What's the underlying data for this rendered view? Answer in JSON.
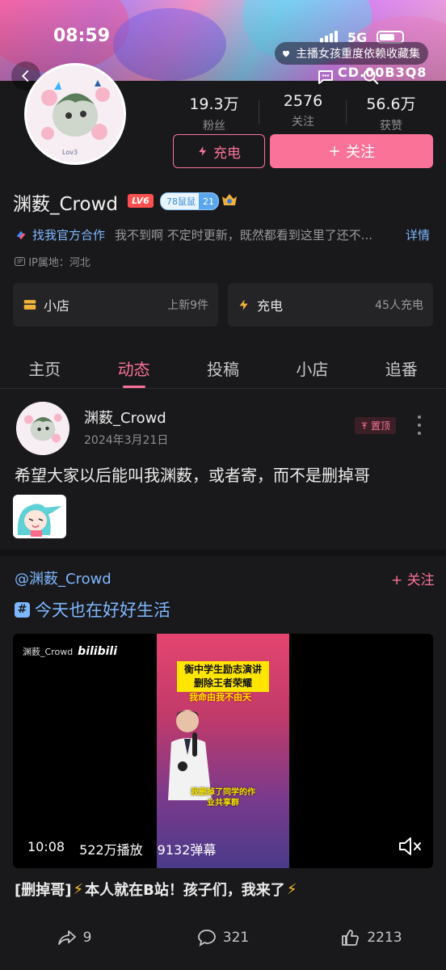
{
  "status_bar": {
    "time": "08:59",
    "network": "5G"
  },
  "banner": {
    "medal_text": "主播女孩重度依赖收藏集",
    "uid_text": "CD.00B3Q8"
  },
  "profile": {
    "stats": [
      {
        "value": "19.3万",
        "label": "粉丝"
      },
      {
        "value": "2576",
        "label": "关注"
      },
      {
        "value": "56.6万",
        "label": "获赞"
      }
    ],
    "charge_button": "充电",
    "follow_button": "关注",
    "name": "渊薮_Crowd",
    "level": "LV6",
    "fan_medal": {
      "name": "78鼠鼠",
      "level": "21"
    },
    "cooperation": "找我官方合作",
    "bio": "我不到啊 不定时更新，既然都看到这里了还不...",
    "more": "详情",
    "ip_label": "IP属地：河北"
  },
  "cards": [
    {
      "title": "小店",
      "subtitle": "上新9件"
    },
    {
      "title": "充电",
      "subtitle": "45人充电"
    }
  ],
  "tabs": [
    {
      "label": "主页",
      "active": false
    },
    {
      "label": "动态",
      "active": true
    },
    {
      "label": "投稿",
      "active": false
    },
    {
      "label": "小店",
      "active": false
    },
    {
      "label": "追番",
      "active": false
    }
  ],
  "post": {
    "author": "渊薮_Crowd",
    "date": "2024年3月21日",
    "pinned_label": "置顶",
    "text": "希望大家以后能叫我渊薮，或者寄，而不是删掉哥",
    "forward": {
      "author": "@渊薮_Crowd",
      "follow_label": "+ 关注",
      "topic": "今天也在好好生活",
      "video": {
        "watermark_name": "渊薮_Crowd",
        "watermark_logo": "bilibili",
        "caption_line1": "衡中学生励志演讲",
        "caption_line2": "删除王者荣耀",
        "caption_red": "我命由我不由天",
        "caption_bottom": "我删掉了同学的作业共享群",
        "duration": "10:08",
        "plays": "522万播放",
        "danmaku": "9132弹幕"
      },
      "title_prefix": "[删掉哥]",
      "title_text": "本人就在B站！孩子们，我来了"
    },
    "actions": {
      "share": "9",
      "comment": "321",
      "like": "2213"
    }
  },
  "colors": {
    "accent": "#fb7299",
    "link": "#7fb7ff",
    "background": "#19191b"
  }
}
